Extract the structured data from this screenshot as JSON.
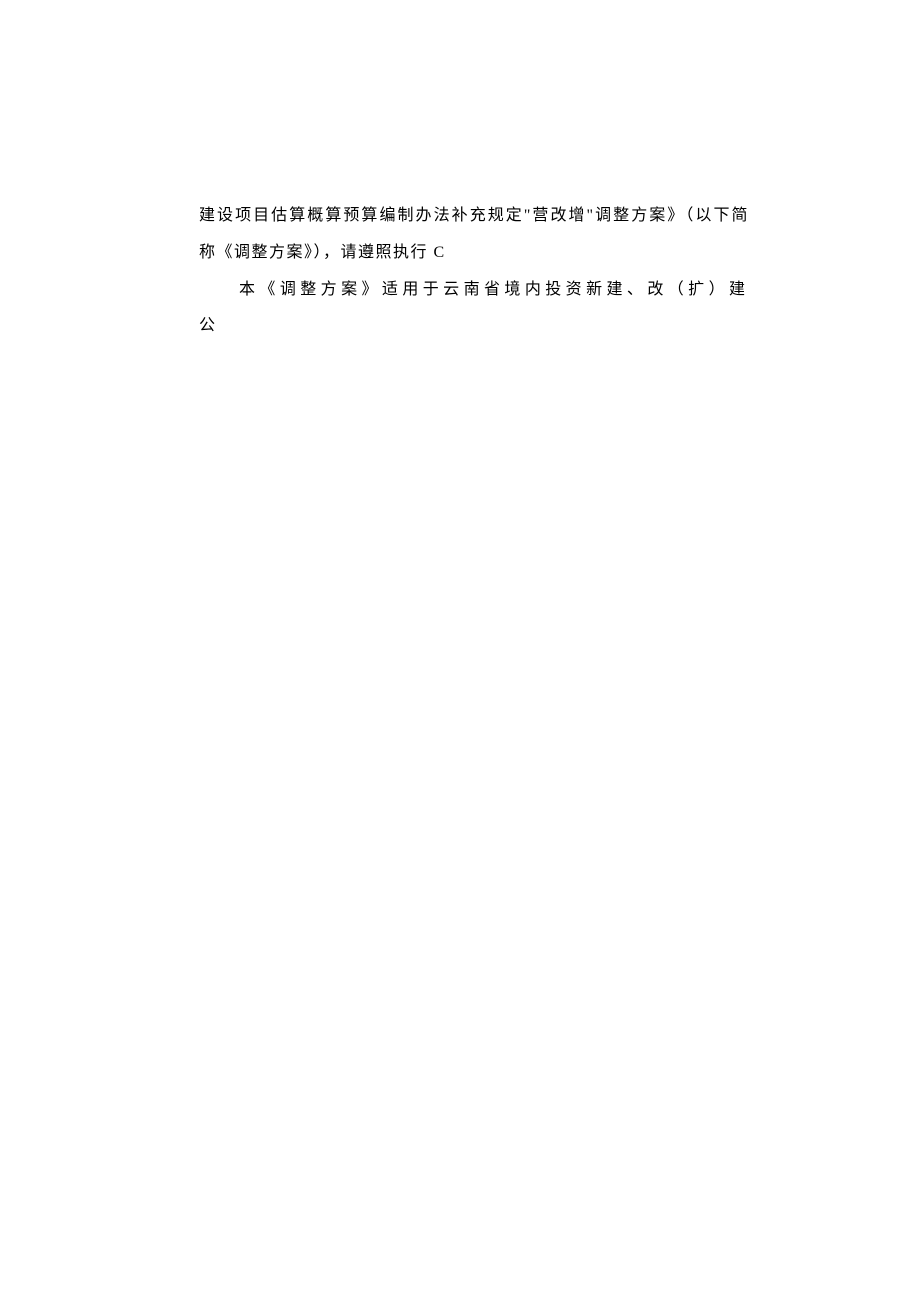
{
  "document": {
    "line1": "建设项目估算概算预算编制办法补充规定\"营改增\"调整方案》（以下简",
    "line2": "称《调整方案》），请遵照执行 C",
    "line3": "本《调整方案》适用于云南省境内投资新建、改（扩）建公"
  }
}
